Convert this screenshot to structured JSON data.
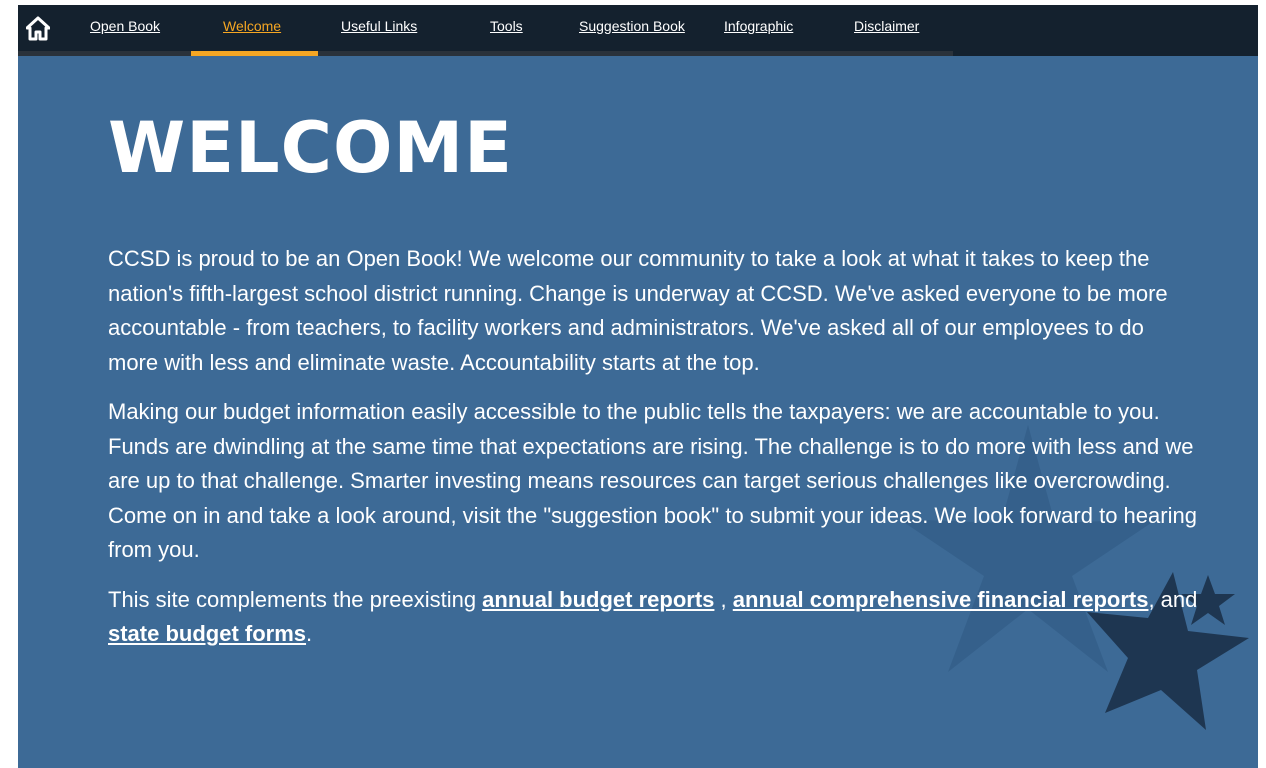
{
  "nav": {
    "home_label": "Home",
    "items": [
      {
        "label": "Open Book"
      },
      {
        "label": "Welcome"
      },
      {
        "label": "Useful Links"
      },
      {
        "label": "Tools"
      },
      {
        "label": "Suggestion Book"
      },
      {
        "label": "Infographic"
      },
      {
        "label": "Disclaimer"
      }
    ],
    "active_color": "#f5a623",
    "bar_color": "#14212e"
  },
  "page": {
    "title": "WELCOME",
    "background_color": "#3d6a96",
    "paragraph1": "CCSD is proud to be an Open Book! We welcome our community to take a look at what it takes to keep the nation's fifth-largest school district running. Change is underway at CCSD. We've asked everyone to be more accountable - from teachers, to facility workers and administrators. We've asked all of our employees to do more with less and eliminate waste. Accountability starts at the top.",
    "paragraph2": "Making our budget information easily accessible to the public tells the taxpayers: we are accountable to you. Funds are dwindling at the same time that expectations are rising. The challenge is to do more with less and we are up to that challenge. Smarter investing means resources can target serious challenges like overcrowding. Come on in and take a look around, visit the \"suggestion book\" to submit your ideas. We look forward to hearing from you.",
    "paragraph3": {
      "prefix": "This site complements the preexisting ",
      "link1": "annual budget reports",
      "sep1": " , ",
      "link2": "annual comprehensive financial reports",
      "sep2": ", and ",
      "link3": "state budget forms",
      "suffix": "."
    }
  }
}
